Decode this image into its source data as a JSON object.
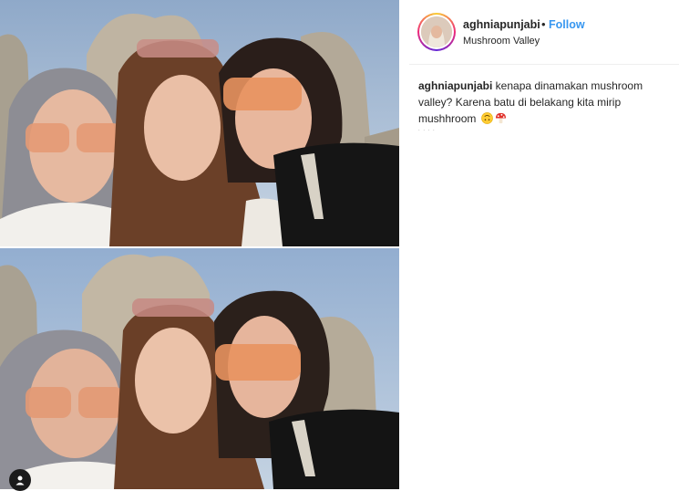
{
  "post": {
    "username": "aghniapunjabi",
    "separator": "•",
    "follow_label": "Follow",
    "location": "Mushroom Valley"
  },
  "caption": {
    "username": "aghniapunjabi",
    "text": " kenapa dinamakan mushroom valley? Karena batu di belakang kita mirip mushhroom ",
    "emojis": [
      "upside-down-face-emoji",
      "mushroom-emoji"
    ]
  },
  "timestamp": ". . . ."
}
